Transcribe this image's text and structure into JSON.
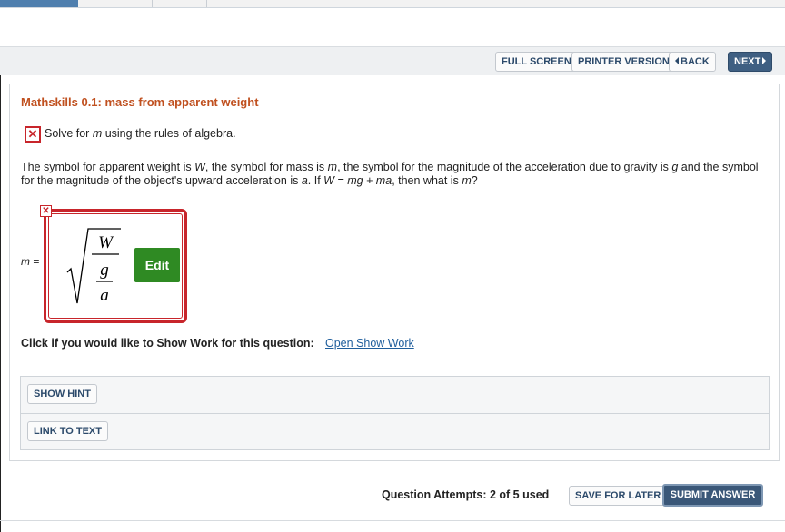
{
  "toolbar": {
    "full_screen": "FULL SCREEN",
    "printer_version": "PRINTER VERSION",
    "back": "BACK",
    "next": "NEXT"
  },
  "question": {
    "title": "Mathskills 0.1: mass from apparent weight",
    "status_icon": "x-mark-icon",
    "instruction_prefix": "Solve for ",
    "instruction_var": "m",
    "instruction_suffix": " using the rules of algebra.",
    "body": {
      "t1": "The symbol for apparent weight is ",
      "W": "W",
      "t2": ", the symbol for mass is ",
      "m": "m",
      "t3": ", the symbol for the magnitude of the acceleration due to gravity is ",
      "g": "g",
      "t4": " and the symbol for the magnitude of the object's upward acceleration is ",
      "a": "a",
      "t5": ". If ",
      "eq": "W = mg + ma",
      "t6": ", then what is ",
      "m2": "m",
      "t7": "?"
    }
  },
  "answer": {
    "label_var": "m",
    "label_eq": " =",
    "numerator": "W",
    "den_num": "g",
    "den_den": "a",
    "edit_label": "Edit",
    "wrong_icon": "x-mark-icon"
  },
  "show_work": {
    "label": "Click if you would like to Show Work for this question:",
    "link": "Open Show Work"
  },
  "hints": {
    "show_hint": "SHOW HINT",
    "link_to_text": "LINK TO TEXT"
  },
  "footer": {
    "attempts": "Question Attempts: 2 of 5 used",
    "save_for_later": "SAVE FOR LATER",
    "submit": "SUBMIT ANSWER"
  },
  "colors": {
    "accent_red": "#c8252b",
    "title_orange": "#c0501f",
    "nav_blue": "#3f5f82",
    "edit_green": "#2f8a23",
    "link_blue": "#1f5e9c"
  }
}
